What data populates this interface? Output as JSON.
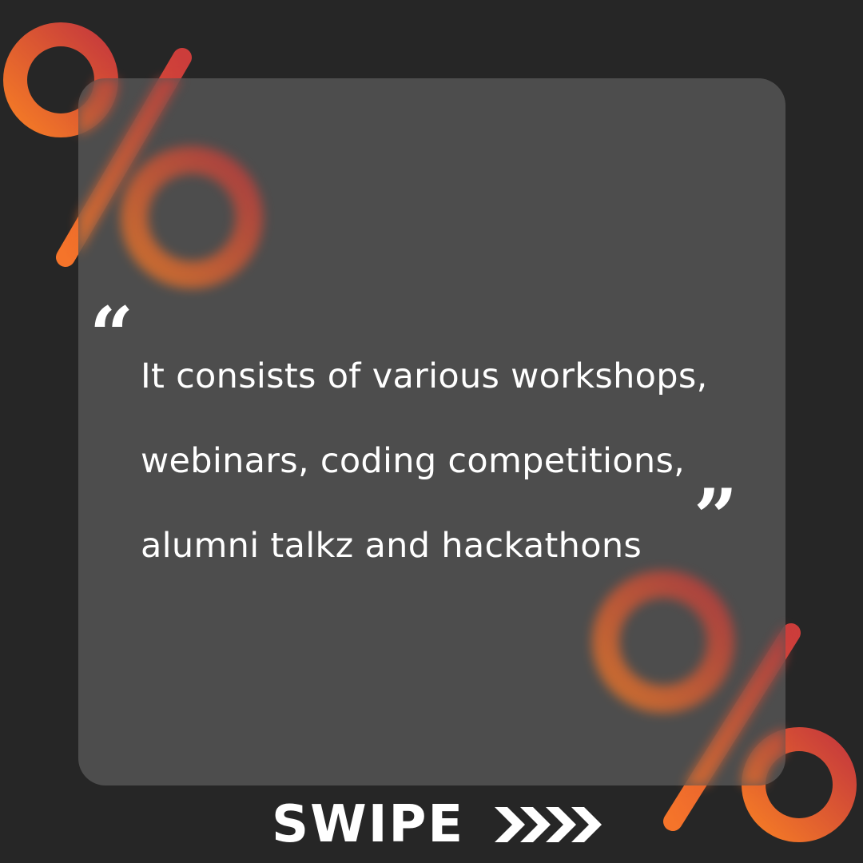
{
  "quote": {
    "lines": [
      "It consists of various workshops,",
      "webinars, coding competitions,",
      "alumni talkz and hackathons"
    ],
    "open_mark": "“",
    "close_mark": "”"
  },
  "swipe": {
    "label": "SWIPE",
    "arrows_icon": "chevron-arrows-right-icon"
  },
  "colors": {
    "background": "#262626",
    "card": "#545454",
    "accent_orange": "#f06a22",
    "accent_red": "#c63a3c",
    "text": "#ffffff"
  },
  "decorations": {
    "top_left": "percent-sign-icon",
    "bottom_right": "percent-sign-icon"
  }
}
